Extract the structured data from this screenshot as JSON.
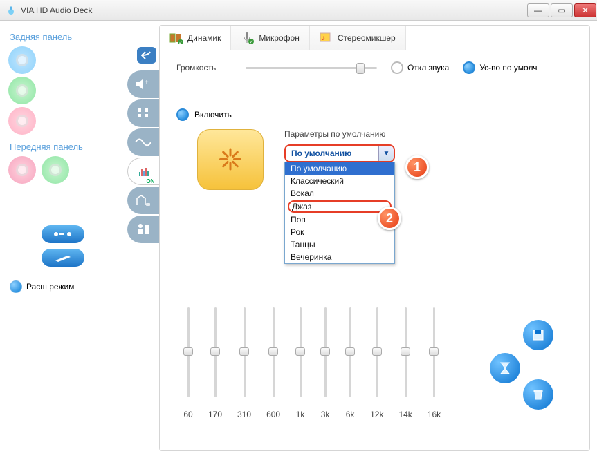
{
  "window": {
    "title": "VIA HD Audio Deck"
  },
  "sidebar": {
    "back_panel_label": "Задняя панель",
    "front_panel_label": "Передняя панель",
    "adv_mode_label": "Расш режим"
  },
  "tabs": {
    "speaker": "Динамик",
    "mic": "Микрофон",
    "stereomix": "Стереомикшер"
  },
  "volume": {
    "label": "Громкость",
    "mute_label": "Откл звука",
    "default_dev_label": "Ус-во по умолч"
  },
  "eq_panel": {
    "enable_label": "Включить",
    "preset_label": "Параметры по умолчанию",
    "selected": "По умолчанию",
    "options": [
      "По умолчанию",
      "Классический",
      "Вокал",
      "Джаз",
      "Поп",
      "Рок",
      "Танцы",
      "Вечеринка"
    ]
  },
  "equalizer": {
    "bands": [
      "60",
      "170",
      "310",
      "600",
      "1k",
      "3k",
      "6k",
      "12k",
      "14k",
      "16k"
    ]
  },
  "callouts": {
    "one": "1",
    "two": "2"
  }
}
